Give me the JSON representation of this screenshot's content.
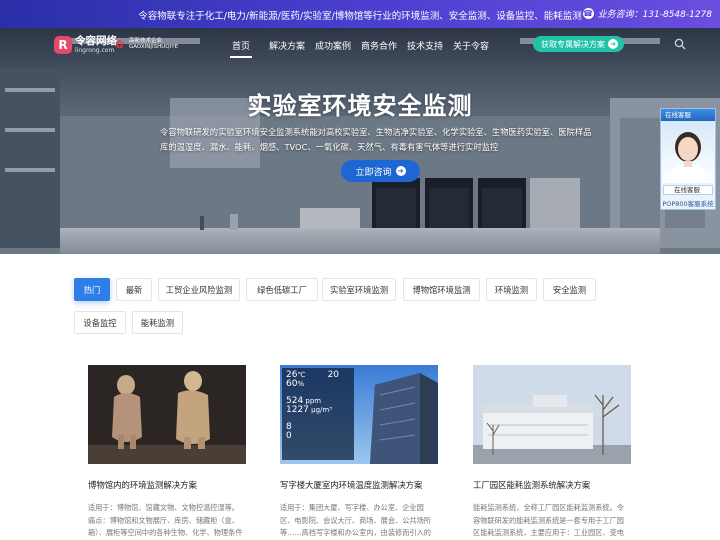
{
  "topbar": {
    "message": "令容物联专注于化工/电力/新能源/医药/实验室/博物馆等行业的环境监测、安全监测、设备监控、能耗监测",
    "phone_label": "业务咨询：",
    "phone": "131-8548-1278"
  },
  "logo": {
    "name": "令容网络",
    "domain": "lingrong.com",
    "badge_line1": "高新技术企业",
    "badge_line2": "GAOXINJISHUQIYE"
  },
  "nav": {
    "items": [
      {
        "label": "首页",
        "active": true
      },
      {
        "label": "解决方案"
      },
      {
        "label": "成功案例"
      },
      {
        "label": "商务合作"
      },
      {
        "label": "技术支持"
      },
      {
        "label": "关于令容"
      }
    ],
    "cta": "获取专属解决方案",
    "icons": {
      "cta": "arrow-right-icon",
      "search": "search-icon"
    }
  },
  "hero": {
    "title": "实验室环境安全监测",
    "description": "令容物联研发的实验室环境安全监测系统能对高校实验室、生物洁净实验室、化学实验室、生物医药实验室、医院样品库的温湿度、漏水、能耗、烟感、TVOC、一氧化碳、天然气、有毒有害气体等进行实时监控",
    "button": "立即咨询"
  },
  "chat_widget": {
    "header": "在线客服",
    "status": "在线客服",
    "footer": "POP800客服系统"
  },
  "filters": [
    {
      "label": "热门",
      "active": true
    },
    {
      "label": "最新"
    },
    {
      "label": "工贸企业风险监测"
    },
    {
      "label": "绿色低碳工厂"
    },
    {
      "label": "实验室环境监测"
    },
    {
      "label": "博物馆环境监测"
    },
    {
      "label": "环境监测"
    },
    {
      "label": "安全监测"
    },
    {
      "label": "设备监控"
    },
    {
      "label": "能耗监测"
    }
  ],
  "cards": [
    {
      "title": "博物馆内的环境监测解决方案",
      "text": "适用于：博物馆、馆藏文物、文物控温控湿等。痛点：博物馆和文物展厅、库房、储藏柜（盒、箱）、展柜等空间中的各种生物、化学、物理条件会导致文物和藏品的损坏、光辐射、温湿度、污染"
    },
    {
      "title": "写字楼大厦室内环境温度监测解决方案",
      "text": "适用于：集团大厦、写字楼、办公室、企业园区、电影院、会议大厅、商场、展会、公共场所等……高档写字楼和办公室内，由装修而引入的化学污染物成分越来越多",
      "dashboard": {
        "temp": "26",
        "temp_unit": "℃",
        "humidity": "60",
        "humidity_unit": "%",
        "pm": "20",
        "co2": "524",
        "co2_unit": "ppm",
        "tvoc": "1227",
        "tvoc_unit": "μg/m³",
        "a": "8",
        "b": "0"
      }
    },
    {
      "title": "工厂园区能耗监测系统解决方案",
      "text": "能耗监测系统，全称工厂园区能耗监测系统。令容物联研发的能耗监测系统是一套专用于工厂园区能耗监测系统，主要应用于：工业园区、变电站、商场、学校、医院、酒店、写字楼、小区等"
    }
  ]
}
